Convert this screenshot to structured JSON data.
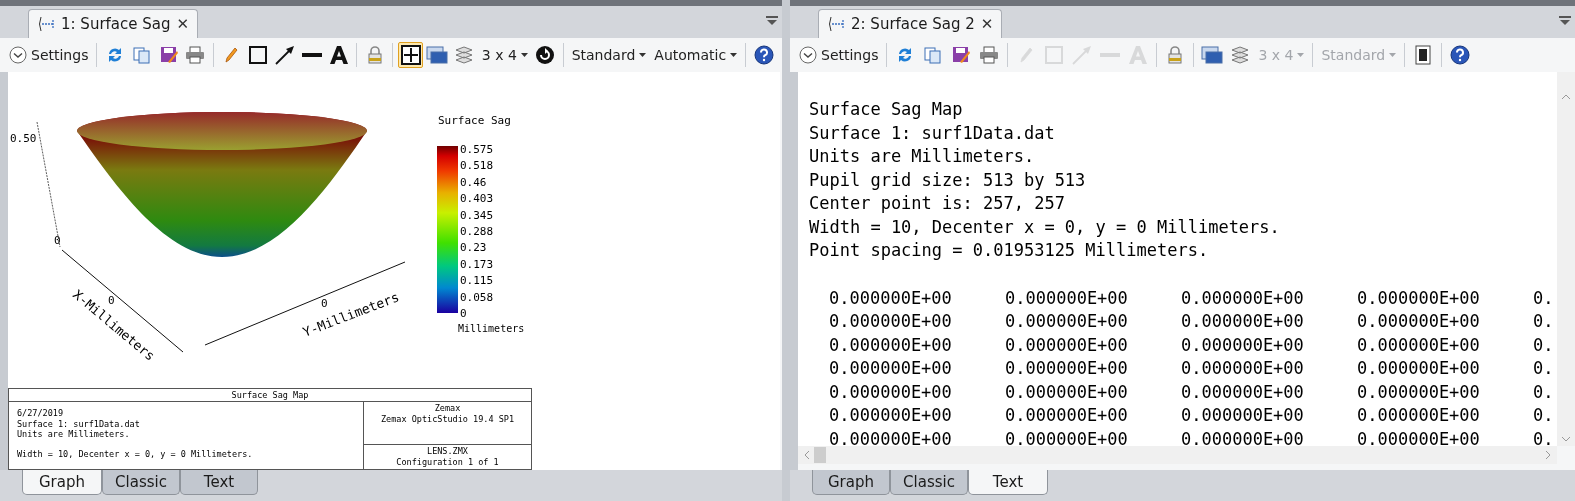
{
  "panels": [
    {
      "tab": {
        "label": "1: Surface Sag",
        "close": "✕"
      },
      "toolbar": [
        {
          "kind": "settings",
          "label": "Settings",
          "disabled": false,
          "selected": false
        },
        {
          "kind": "separator"
        },
        {
          "kind": "refresh",
          "disabled": false,
          "selected": false
        },
        {
          "kind": "copy",
          "disabled": false,
          "selected": false
        },
        {
          "kind": "save",
          "disabled": false,
          "selected": false
        },
        {
          "kind": "print",
          "disabled": false,
          "selected": false
        },
        {
          "kind": "separator"
        },
        {
          "kind": "pencil",
          "disabled": false,
          "selected": false
        },
        {
          "kind": "square",
          "disabled": false,
          "selected": false
        },
        {
          "kind": "arrow",
          "disabled": false,
          "selected": false
        },
        {
          "kind": "line",
          "disabled": false,
          "selected": false
        },
        {
          "kind": "text",
          "disabled": false,
          "selected": false
        },
        {
          "kind": "separator"
        },
        {
          "kind": "lock",
          "disabled": false,
          "selected": false
        },
        {
          "kind": "separator"
        },
        {
          "kind": "grid",
          "disabled": false,
          "selected": true
        },
        {
          "kind": "window",
          "disabled": false,
          "selected": false
        },
        {
          "kind": "layers",
          "disabled": false,
          "selected": false
        },
        {
          "kind": "dropdown",
          "label": "3 x 4",
          "disabled": false,
          "selected": false
        },
        {
          "kind": "rotate",
          "disabled": false,
          "selected": false
        },
        {
          "kind": "separator"
        },
        {
          "kind": "dropdown",
          "label": "Standard",
          "disabled": false,
          "selected": false
        },
        {
          "kind": "dropdown",
          "label": "Automatic",
          "disabled": false,
          "selected": false
        },
        {
          "kind": "separator"
        },
        {
          "kind": "help",
          "disabled": false,
          "selected": false
        }
      ],
      "view": {
        "kind": "graph",
        "plot": {
          "z_ticks": [
            "0.50",
            "0"
          ],
          "x_tick": "0",
          "x_label": "X-Millimeters",
          "y_tick": "0",
          "y_label": "Y-Millimeters",
          "legend": {
            "title": "Surface Sag",
            "values": [
              "0.575",
              "0.518",
              "0.46",
              "0.403",
              "0.345",
              "0.288",
              "0.23",
              "0.173",
              "0.115",
              "0.058",
              "0"
            ],
            "unit": "Millimeters"
          }
        },
        "footer": {
          "title": "Surface Sag Map",
          "info": [
            "6/27/2019",
            "Surface 1: surf1Data.dat",
            "Units are Millimeters."
          ],
          "note": "Width = 10, Decenter x = 0, y = 0 Millimeters.",
          "program": [
            "Zemax",
            "Zemax OpticStudio 19.4 SP1"
          ],
          "file": [
            "LENS.ZMX",
            "Configuration 1 of 1"
          ]
        }
      },
      "bottom_tabs": [
        {
          "label": "Graph",
          "selected": true
        },
        {
          "label": "Classic",
          "selected": false
        },
        {
          "label": "Text",
          "selected": false
        }
      ]
    },
    {
      "tab": {
        "label": "2: Surface Sag 2",
        "close": "✕"
      },
      "toolbar": [
        {
          "kind": "settings",
          "label": "Settings",
          "disabled": false,
          "selected": false
        },
        {
          "kind": "separator"
        },
        {
          "kind": "refresh",
          "disabled": false,
          "selected": false
        },
        {
          "kind": "copy",
          "disabled": false,
          "selected": false
        },
        {
          "kind": "save",
          "disabled": false,
          "selected": false
        },
        {
          "kind": "print",
          "disabled": false,
          "selected": false
        },
        {
          "kind": "separator"
        },
        {
          "kind": "pencil",
          "disabled": true,
          "selected": false
        },
        {
          "kind": "square",
          "disabled": true,
          "selected": false
        },
        {
          "kind": "arrow",
          "disabled": true,
          "selected": false
        },
        {
          "kind": "line",
          "disabled": true,
          "selected": false
        },
        {
          "kind": "text",
          "disabled": true,
          "selected": false
        },
        {
          "kind": "separator"
        },
        {
          "kind": "lock",
          "disabled": false,
          "selected": false
        },
        {
          "kind": "separator"
        },
        {
          "kind": "window",
          "disabled": false,
          "selected": false
        },
        {
          "kind": "layers",
          "disabled": false,
          "selected": false
        },
        {
          "kind": "dropdown",
          "label": "3 x 4",
          "disabled": true,
          "selected": false
        },
        {
          "kind": "separator"
        },
        {
          "kind": "dropdown",
          "label": "Standard",
          "disabled": true,
          "selected": false
        },
        {
          "kind": "separator"
        },
        {
          "kind": "page",
          "disabled": false,
          "selected": false
        },
        {
          "kind": "separator"
        },
        {
          "kind": "help",
          "disabled": false,
          "selected": false
        }
      ],
      "view": {
        "kind": "text",
        "header": [
          "Surface Sag Map",
          "Surface 1: surf1Data.dat",
          "Units are Millimeters.",
          "Pupil grid size: 513 by 513",
          "Center point is: 257, 257",
          "Width = 10, Decenter x = 0, y = 0 Millimeters.",
          "Point spacing = 0.01953125 Millimeters."
        ],
        "rows": [
          [
            "0.000000E+00",
            "0.000000E+00",
            "0.000000E+00",
            "0.000000E+00",
            "0."
          ],
          [
            "0.000000E+00",
            "0.000000E+00",
            "0.000000E+00",
            "0.000000E+00",
            "0."
          ],
          [
            "0.000000E+00",
            "0.000000E+00",
            "0.000000E+00",
            "0.000000E+00",
            "0."
          ],
          [
            "0.000000E+00",
            "0.000000E+00",
            "0.000000E+00",
            "0.000000E+00",
            "0."
          ],
          [
            "0.000000E+00",
            "0.000000E+00",
            "0.000000E+00",
            "0.000000E+00",
            "0."
          ],
          [
            "0.000000E+00",
            "0.000000E+00",
            "0.000000E+00",
            "0.000000E+00",
            "0."
          ],
          [
            "0.000000E+00",
            "0.000000E+00",
            "0.000000E+00",
            "0.000000E+00",
            "0."
          ]
        ]
      },
      "bottom_tabs": [
        {
          "label": "Graph",
          "selected": false
        },
        {
          "label": "Classic",
          "selected": false
        },
        {
          "label": "Text",
          "selected": true
        }
      ]
    }
  ]
}
